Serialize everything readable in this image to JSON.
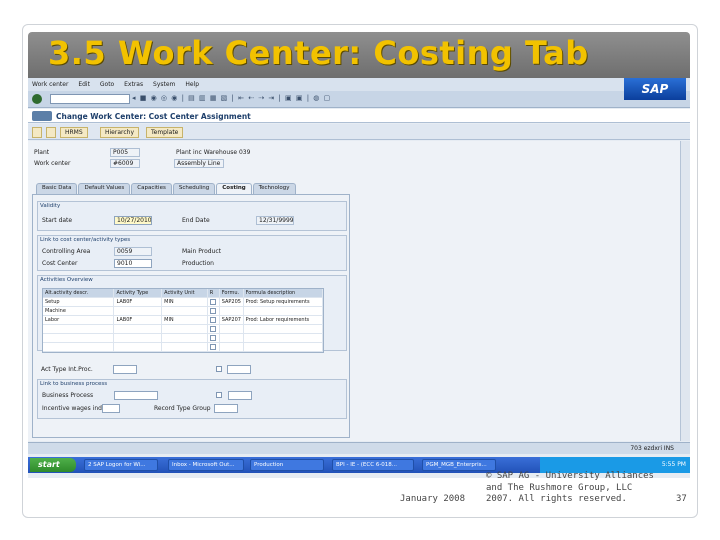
{
  "slide": {
    "title": "3.5 Work Center: Costing Tab",
    "footer_date": "January 2008",
    "footer_copy_line1": "© SAP AG - University Alliances",
    "footer_copy_line2": "and The Rushmore Group, LLC",
    "footer_copy_line3": "2007. All rights reserved.",
    "page_number": "37",
    "logo_text": "SAP"
  },
  "sap": {
    "menu": [
      "Work center",
      "Edit",
      "Goto",
      "Extras",
      "System",
      "Help"
    ],
    "screen_title": "Change Work Center: Cost Center Assignment",
    "toolbar_buttons": [
      "HRMS",
      "Hierarchy",
      "Template"
    ],
    "header": {
      "plant_label": "Plant",
      "plant_value": "P005",
      "plant_desc": "Plant inc Warehouse 039",
      "workcenter_label": "Work center",
      "workcenter_value": "#6009",
      "workcenter_desc": "Assembly Line"
    },
    "tabs": [
      "Basic Data",
      "Default Values",
      "Capacities",
      "Scheduling",
      "Costing",
      "Technology"
    ],
    "active_tab": "Costing",
    "validity": {
      "title": "Validity",
      "start_label": "Start date",
      "start_value": "10/27/2010",
      "end_label": "End Date",
      "end_value": "12/31/9999"
    },
    "cost_center": {
      "title": "Link to cost center/activity types",
      "controlling_label": "Controlling Area",
      "controlling_value": "0059",
      "controlling_desc": "Main Product",
      "cost_center_label": "Cost Center",
      "cost_center_value": "9010",
      "cost_center_desc": "Production"
    },
    "activities": {
      "title": "Activities Overview",
      "headers": [
        "Alt.activity descr.",
        "Activity Type",
        "Activity Unit",
        "R",
        "Formu.",
        "Formula description"
      ],
      "rows": [
        [
          "Setup",
          "LAB0F",
          "MIN",
          "",
          "SAP205",
          "Prod: Setup requirements"
        ],
        [
          "Machine",
          "",
          "",
          "",
          "",
          ""
        ],
        [
          "Labor",
          "LAB0F",
          "MIN",
          "",
          "SAP207",
          "Prod: Labor requirements"
        ],
        [
          "",
          "",
          "",
          "",
          "",
          ""
        ],
        [
          "",
          "",
          "",
          "",
          "",
          ""
        ],
        [
          "",
          "",
          "",
          "",
          "",
          ""
        ]
      ]
    },
    "act_type_label": "Act Type Int.Proc.",
    "business_process": {
      "title": "Link to business process",
      "bp_label": "Business Process",
      "incentive_label": "Incentive wages ind.",
      "record_label": "Record Type Group"
    },
    "status_right": "703  ezdxri  INS",
    "taskbar": {
      "start": "start",
      "tasks": [
        "2 SAP Logon for Wi...",
        "Inbox - Microsoft Out...",
        "Production",
        "BPI - IE - (ECC 6-018...",
        "PGM_MGB_Enterpris..."
      ],
      "clock": "5:55 PM"
    }
  }
}
